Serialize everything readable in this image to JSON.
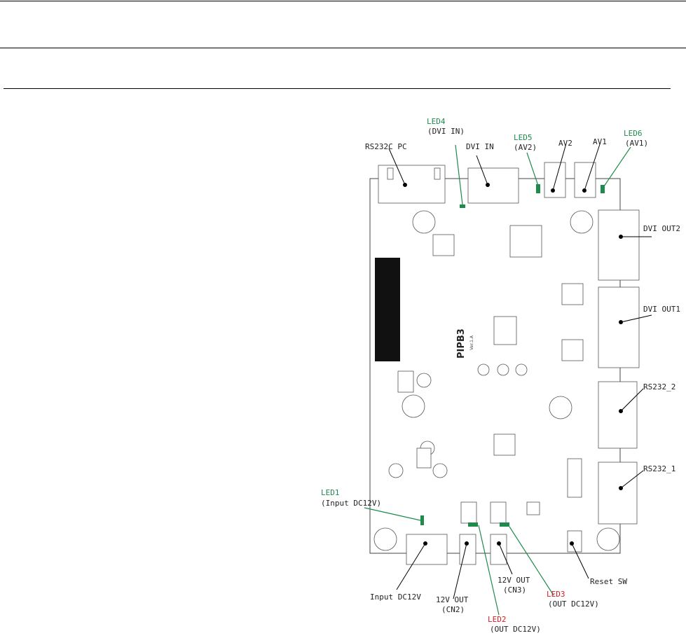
{
  "diagram": {
    "board_name": "PIPB3",
    "board_version": "Ver.1.A",
    "accent_colors": {
      "led_label": "#1f8a4c",
      "led_label_alt": "#d0202a"
    },
    "labels": {
      "rs232c_pc": "RS232C PC",
      "led4": "LED4",
      "led4_desc": "(DVI IN)",
      "dvi_in": "DVI IN",
      "led5": "LED5",
      "led5_desc": "(AV2)",
      "av2": "AV2",
      "av1": "AV1",
      "led6": "LED6",
      "led6_desc": "(AV1)",
      "dvi_out2": "DVI OUT2",
      "dvi_out1": "DVI OUT1",
      "rs232_2": "RS232_2",
      "rs232_1": "RS232_1",
      "led1": "LED1",
      "led1_desc": "(Input DC12V)",
      "input_dc12v": "Input DC12V",
      "out_cn2_1": "12V OUT",
      "out_cn2_2": "(CN2)",
      "out_cn3_1": "12V OUT",
      "out_cn3_2": "(CN3)",
      "led2": "LED2",
      "led2_desc": "(OUT DC12V)",
      "led3": "LED3",
      "led3_desc": "(OUT DC12V)",
      "reset_sw": "Reset SW"
    }
  }
}
